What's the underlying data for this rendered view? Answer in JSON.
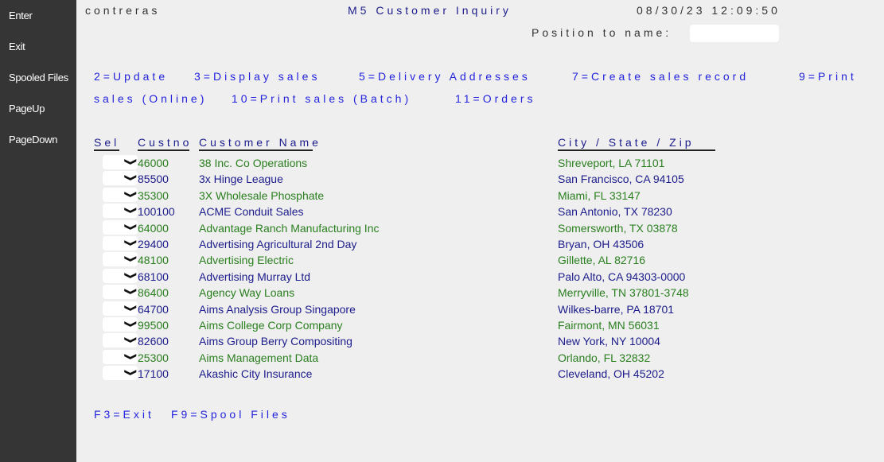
{
  "sidebar": {
    "buttons": [
      {
        "label": "Enter"
      },
      {
        "label": "Exit"
      },
      {
        "label": "Spooled Files"
      },
      {
        "label": "PageUp"
      },
      {
        "label": "PageDown"
      }
    ]
  },
  "header": {
    "user": "contreras",
    "title": "M5 Customer Inquiry",
    "datetime": "08/30/23 12:09:50",
    "position_label": "Position to name:",
    "position_value": ""
  },
  "options": {
    "line1": [
      "2=Update",
      "3=Display sales",
      "5=Delivery Addresses",
      "7=Create sales record",
      "9=Print"
    ],
    "line2": [
      "sales (Online)",
      "10=Print sales (Batch)",
      "11=Orders"
    ]
  },
  "table": {
    "headers": {
      "sel": "Sel",
      "custno": "Custno",
      "name": "Customer Name",
      "city": "City / State / Zip"
    },
    "colors": {
      "green": "#2a7f1f",
      "navy": "#1c1c8c"
    },
    "rows": [
      {
        "custno": "46000",
        "name": "38 Inc. Co Operations",
        "city": "Shreveport, LA 71101",
        "color": "green"
      },
      {
        "custno": "85500",
        "name": "3x Hinge League",
        "city": "San Francisco, CA 94105",
        "color": "navy"
      },
      {
        "custno": "35300",
        "name": "3X Wholesale Phosphate",
        "city": "Miami, FL 33147",
        "color": "green"
      },
      {
        "custno": "100100",
        "name": "ACME Conduit Sales",
        "city": "San Antonio, TX 78230",
        "color": "navy"
      },
      {
        "custno": "64000",
        "name": "Advantage Ranch Manufacturing Inc",
        "city": "Somersworth, TX 03878",
        "color": "green"
      },
      {
        "custno": "29400",
        "name": "Advertising Agricultural 2nd Day",
        "city": "Bryan, OH 43506",
        "color": "navy"
      },
      {
        "custno": "48100",
        "name": "Advertising Electric",
        "city": "Gillette, AL 82716",
        "color": "green"
      },
      {
        "custno": "68100",
        "name": "Advertising Murray Ltd",
        "city": "Palo Alto, CA 94303-0000",
        "color": "navy"
      },
      {
        "custno": "86400",
        "name": "Agency Way Loans",
        "city": "Merryville, TN 37801-3748",
        "color": "green"
      },
      {
        "custno": "64700",
        "name": "Aims Analysis Group Singapore",
        "city": "Wilkes-barre, PA 18701",
        "color": "navy"
      },
      {
        "custno": "99500",
        "name": "Aims College Corp Company",
        "city": "Fairmont, MN 56031",
        "color": "green"
      },
      {
        "custno": "82600",
        "name": "Aims Group Berry Compositing",
        "city": "New York, NY 10004",
        "color": "navy"
      },
      {
        "custno": "25300",
        "name": "Aims Management Data",
        "city": "Orlando, FL 32832",
        "color": "green"
      },
      {
        "custno": "17100",
        "name": "Akashic City Insurance",
        "city": "Cleveland, OH 45202",
        "color": "navy"
      }
    ]
  },
  "footer": {
    "keys": [
      "F3=Exit",
      "F9=Spool Files"
    ]
  }
}
